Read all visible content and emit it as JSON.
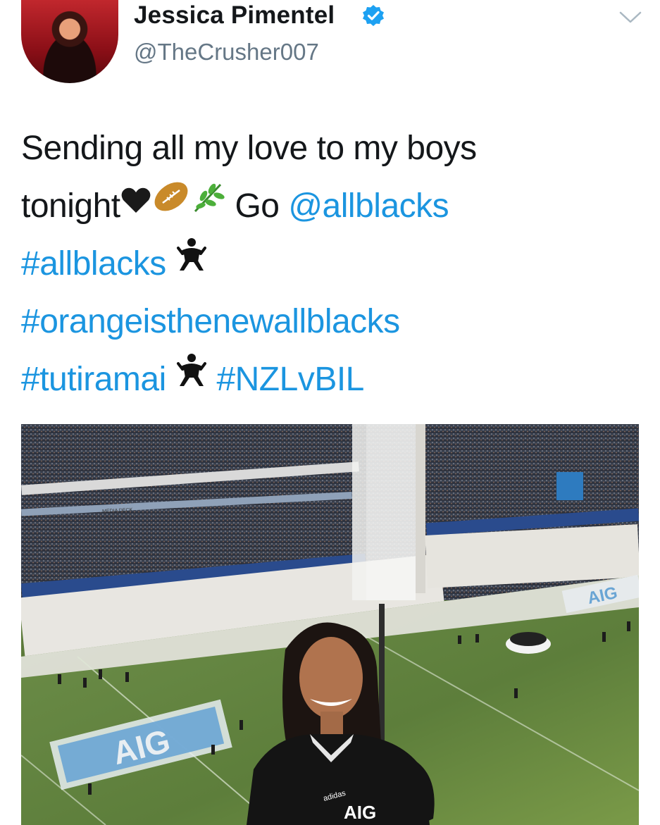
{
  "tweet": {
    "author": {
      "display_name": "Jessica Pimentel",
      "handle": "@TheCrusher007",
      "verified": true,
      "verified_icon": "verified-badge-icon"
    },
    "menu_icon": "chevron-down-icon",
    "text_lines": [
      {
        "parts": [
          {
            "t": "Sending all my love to my boys",
            "link": false
          }
        ]
      },
      {
        "parts": [
          {
            "t": "tonight",
            "link": false
          },
          {
            "emoji": "heart"
          },
          {
            "emoji": "rugby-ball"
          },
          {
            "emoji": "herb"
          },
          {
            "t": " Go ",
            "link": false
          },
          {
            "t": "@allblacks",
            "link": true
          }
        ]
      },
      {
        "parts": [
          {
            "t": "#allblacks",
            "link": true
          },
          {
            "t": " ",
            "link": false
          },
          {
            "emoji": "wrestler"
          }
        ]
      },
      {
        "parts": [
          {
            "t": "#orangeisthenewallblacks",
            "link": true
          }
        ]
      },
      {
        "parts": [
          {
            "t": "#tutiramai",
            "link": true
          },
          {
            "t": " ",
            "link": false
          },
          {
            "emoji": "wrestler"
          },
          {
            "t": "  ",
            "link": false
          },
          {
            "t": "#NZLvBIL",
            "link": true
          }
        ]
      }
    ],
    "media": {
      "signage": {
        "media_deck": "MEDIA DECK",
        "field_logo_left": "AIG",
        "field_logo_right": "AIG",
        "jersey_sponsor": "AIG",
        "jersey_brand": "adidas"
      }
    }
  },
  "colors": {
    "link": "#1b95e0",
    "verified": "#1da1f2",
    "handle": "#657786"
  }
}
